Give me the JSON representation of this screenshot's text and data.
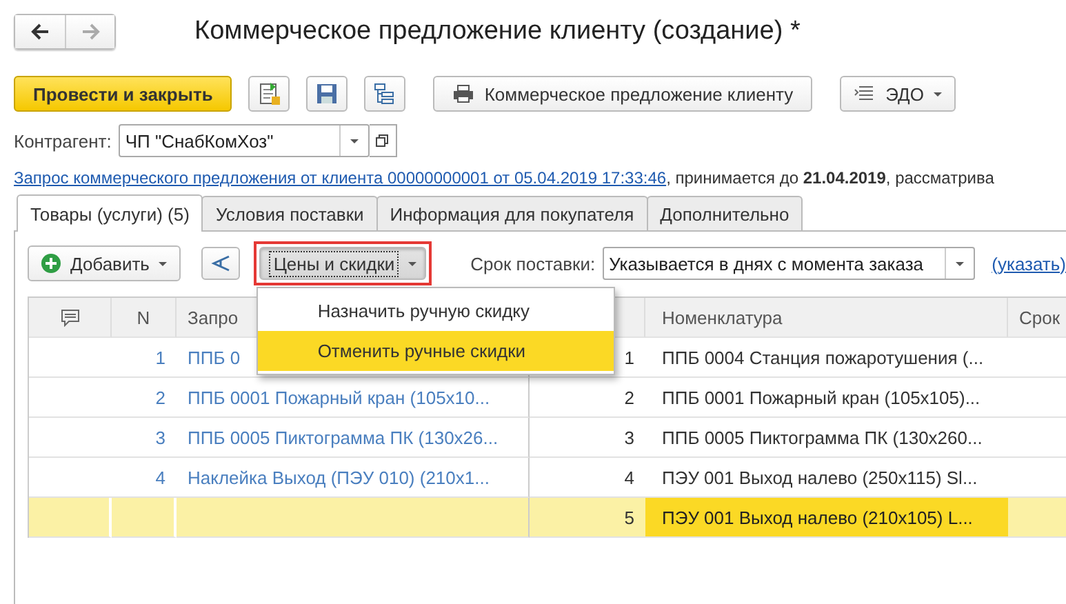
{
  "window": {
    "title": "Коммерческое предложение клиенту (создание) *"
  },
  "toolbar": {
    "primary": "Провести и закрыть",
    "print_button": "Коммерческое предложение клиенту",
    "edo_button": "ЭДО"
  },
  "counterparty": {
    "label": "Контрагент:",
    "value": "ЧП \"СнабКомХоз\""
  },
  "info_line": {
    "link": "Запрос коммерческого предложения от клиента 00000000001 от 05.04.2019 17:33:46",
    "text": ", принимается до **21.04.2019**, рассматрива"
  },
  "tabs": [
    {
      "label": "Товары (услуги) (5)",
      "selected": true
    },
    {
      "label": "Условия поставки",
      "selected": false
    },
    {
      "label": "Информация для покупателя",
      "selected": false
    },
    {
      "label": "Дополнительно",
      "selected": false
    }
  ],
  "table_toolbar": {
    "add_button": "Добавить",
    "prices_button": {
      "label": "Цены и скидки",
      "highlighted": true,
      "expanded": true
    },
    "delivery_label": "Срок поставки:",
    "delivery_value": "Указывается в днях с момента заказа",
    "specify_link": "(указать)"
  },
  "prices_menu": [
    {
      "label": "Назначить ручную скидку",
      "selected": false
    },
    {
      "label": "Отменить ручные скидки",
      "selected": true
    }
  ],
  "table": {
    "columns": [
      "N",
      "Запро",
      "Номенклатура",
      "Срок"
    ],
    "rows": [
      {
        "n": "1",
        "request": "ППБ 0",
        "line": "1",
        "nomenclature": "ППБ 0004 Станция пожаротушения (...",
        "selected": false
      },
      {
        "n": "2",
        "request": "ППБ 0001 Пожарный кран (105х10...",
        "line": "2",
        "nomenclature": "ППБ 0001 Пожарный кран (105х105)...",
        "selected": false
      },
      {
        "n": "3",
        "request": "ППБ 0005 Пиктограмма ПК (130х26...",
        "line": "3",
        "nomenclature": "ППБ 0005 Пиктограмма ПК (130х260...",
        "selected": false
      },
      {
        "n": "4",
        "request": "Наклейка Выход (ПЭУ 010) (210х1...",
        "line": "4",
        "nomenclature": "ПЭУ 001 Выход налево (250х115) Sl...",
        "selected": false
      },
      {
        "line": "5",
        "nomenclature": "ПЭУ 001 Выход налево (210х105) L...",
        "selected": true
      }
    ]
  }
}
